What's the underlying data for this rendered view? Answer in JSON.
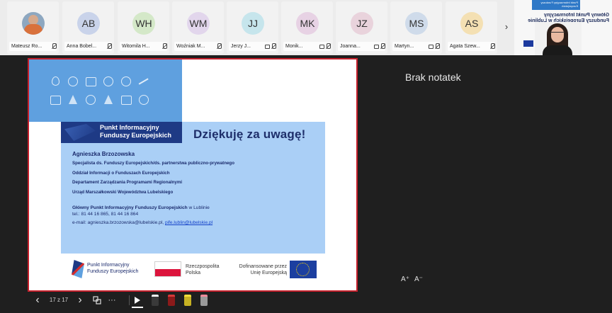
{
  "participants": [
    {
      "initials": "",
      "name": "Mateusz Ro...",
      "color": "#8da7c0",
      "photo": true
    },
    {
      "initials": "AB",
      "name": "Anna Bobel...",
      "color": "#c9d3ea"
    },
    {
      "initials": "WH",
      "name": "Witomila H...",
      "color": "#d4e8c8"
    },
    {
      "initials": "WM",
      "name": "Woźniak M...",
      "color": "#e2d6ec"
    },
    {
      "initials": "JJ",
      "name": "Jerzy J...",
      "color": "#c6e5ec"
    },
    {
      "initials": "MK",
      "name": "Monik...",
      "color": "#e7d2e4"
    },
    {
      "initials": "JZ",
      "name": "Joanna...",
      "color": "#e9d3dc"
    },
    {
      "initials": "MS",
      "name": "Martyn...",
      "color": "#cfdbea"
    },
    {
      "initials": "AS",
      "name": "Agata Szew...",
      "color": "#f4e0b3"
    }
  ],
  "strip_chevron": "›",
  "share_tile": {
    "bar_text": "Punkt Informacyjny Funduszy Europejskich",
    "mirror_text_1": "Główny Punkt Informacyjny",
    "mirror_text_2": "Funduszy Europejskich w Lublinie"
  },
  "slide": {
    "header_logo_line1": "Punkt Informacyjny",
    "header_logo_line2": "Funduszy Europejskich",
    "thanks": "Dziękuję za uwagę!",
    "person_name": "Agnieszka Brzozowska",
    "lines": [
      "Specjalista ds. Funduszy Europejskich/ds. partnerstwa publiczno-prywatnego",
      "Oddział Informacji o Funduszach Europejskich",
      "Departament Zarządzania Programami Regionalnymi",
      "Urząd Marszałkowski Województwa Lubelskiego"
    ],
    "contact_bold": "Główny Punkt Informacyjny Funduszy Europejskich",
    "contact_suffix": " w Lublinie",
    "phone": "tel.: 81 44 16 865, 81 44 16 864",
    "email_prefix": "e-mail: agnieszka.brzozowska@lubelskie.pl, ",
    "email_link": "pife.lublin@lubelskie.pl",
    "logo_pife_1": "Punkt Informacyjny",
    "logo_pife_2": "Funduszy Europejskich",
    "logo_rp_1": "Rzeczpospolita",
    "logo_rp_2": "Polska",
    "logo_eu_1": "Dofinansowane przez",
    "logo_eu_2": "Unię Europejską"
  },
  "notes_text": "Brak notatek",
  "font_increase": "A⁺",
  "font_decrease": "A⁻",
  "toolbar": {
    "prev": "‹",
    "counter": "17 z 17",
    "next": "›",
    "more": "···"
  },
  "colors": {
    "accent_blue": "#5fa0df",
    "navy": "#1e3a85",
    "slide_border": "#c6202c"
  }
}
